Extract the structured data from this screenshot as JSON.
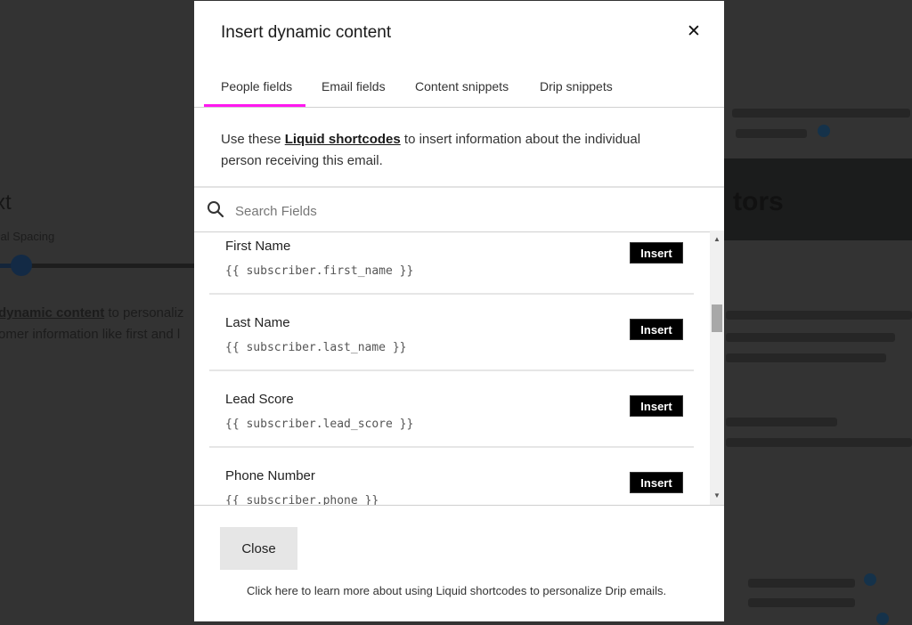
{
  "background": {
    "heading": "xt",
    "spacing_label": "cal Spacing",
    "slider_value_fraction": 0.05,
    "text_line_1_link": "dynamic content",
    "text_line_1_rest": " to personaliz",
    "text_line_2": "omer information like first and l",
    "right_band_text": "tors"
  },
  "modal": {
    "title": "Insert dynamic content",
    "close_icon": "close-x-icon",
    "tabs": [
      {
        "label": "People fields",
        "active": true
      },
      {
        "label": "Email fields",
        "active": false
      },
      {
        "label": "Content snippets",
        "active": false
      },
      {
        "label": "Drip snippets",
        "active": false
      }
    ],
    "accent_color": "#ff18f0",
    "intro": {
      "before": "Use these ",
      "link": "Liquid shortcodes",
      "after": " to insert information about the individual person receiving this email."
    },
    "search": {
      "icon": "search-icon",
      "placeholder": "Search Fields",
      "value": ""
    },
    "fields": [
      {
        "name": "First Name",
        "code": "{{ subscriber.first_name }}",
        "button": "Insert"
      },
      {
        "name": "Last Name",
        "code": "{{ subscriber.last_name }}",
        "button": "Insert"
      },
      {
        "name": "Lead Score",
        "code": "{{ subscriber.lead_score }}",
        "button": "Insert"
      },
      {
        "name": "Phone Number",
        "code": "{{ subscriber.phone }}",
        "button": "Insert"
      }
    ],
    "scrollbar": {
      "up_icon": "▲",
      "down_icon": "▼"
    },
    "close_button": "Close",
    "learn_more": "Click here to learn more about using Liquid shortcodes to personalize Drip emails."
  }
}
